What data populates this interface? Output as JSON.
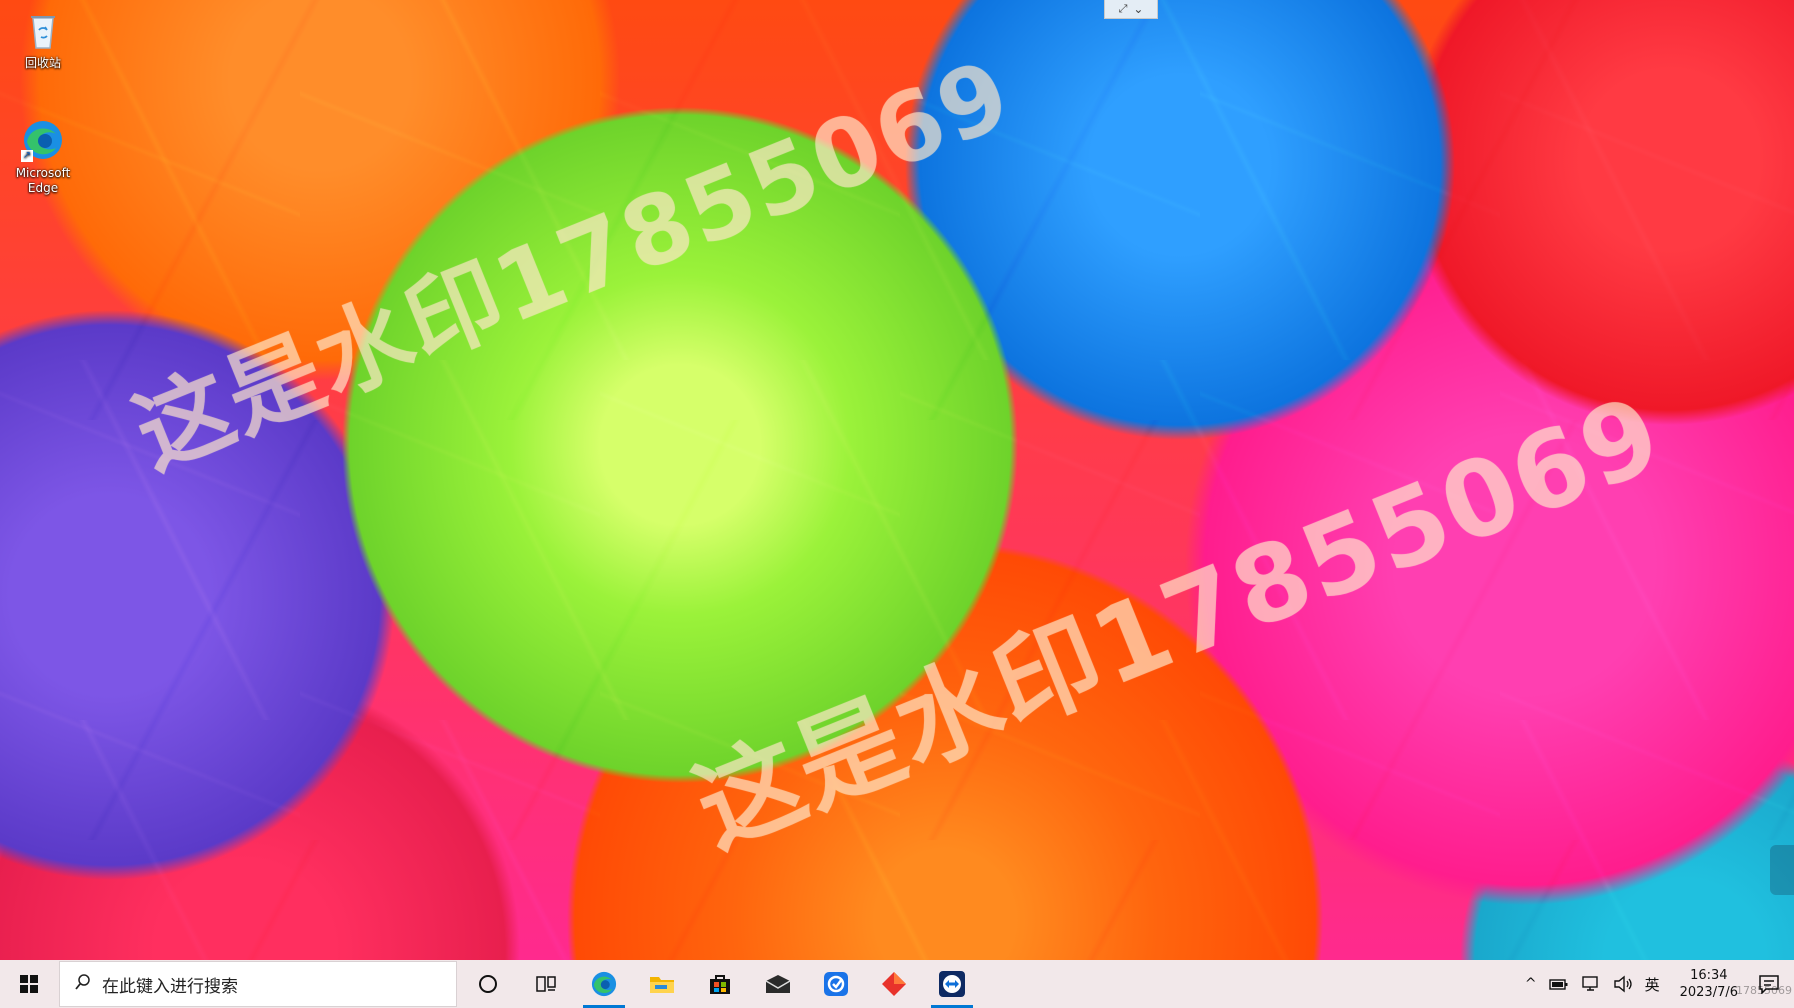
{
  "desktop": {
    "icons": [
      {
        "label": "回收站",
        "icon": "recycle-bin-icon"
      },
      {
        "label": "Microsoft Edge",
        "icon": "edge-icon"
      }
    ],
    "watermarks": [
      {
        "text": "这是水印17855069"
      },
      {
        "text": "这是水印17855069"
      }
    ]
  },
  "taskbar": {
    "search_placeholder": "在此键入进行搜索",
    "pinned": [
      {
        "name": "cortana-icon"
      },
      {
        "name": "task-view-icon"
      },
      {
        "name": "edge-icon"
      },
      {
        "name": "file-explorer-icon"
      },
      {
        "name": "store-icon"
      },
      {
        "name": "mail-icon"
      },
      {
        "name": "app-blue-icon"
      },
      {
        "name": "app-red-icon"
      },
      {
        "name": "teamviewer-icon"
      }
    ],
    "tray": {
      "ime": "英",
      "time": "16:34",
      "date": "2023/7/6",
      "overlay_text": "17855069"
    }
  },
  "colors": {
    "taskbar_bg": "#f2e8ea",
    "accent": "#0078d4"
  }
}
